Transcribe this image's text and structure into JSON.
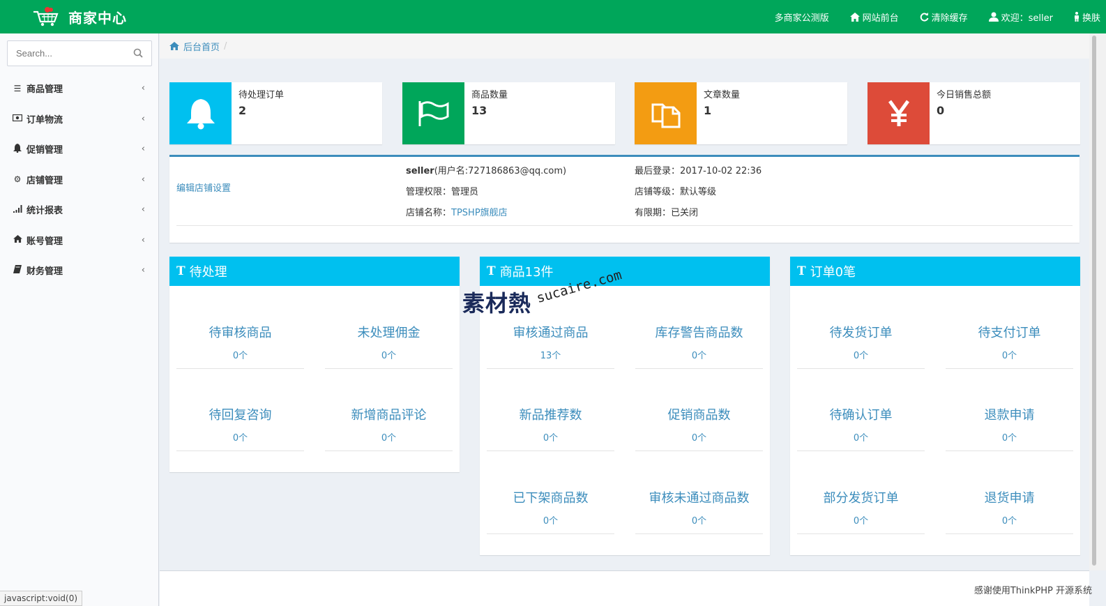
{
  "header": {
    "title": "商家中心",
    "nav": [
      {
        "label": "多商家公测版",
        "icon": ""
      },
      {
        "label": "网站前台",
        "icon": "home-icon"
      },
      {
        "label": "清除缓存",
        "icon": "refresh-icon"
      },
      {
        "label": "欢迎：seller",
        "icon": "user-icon"
      },
      {
        "label": "换肤",
        "icon": "male-icon"
      }
    ]
  },
  "sidebar": {
    "search_placeholder": "Search...",
    "items": [
      {
        "label": "商品管理",
        "icon": "list-icon"
      },
      {
        "label": "订单物流",
        "icon": "money-icon"
      },
      {
        "label": "促销管理",
        "icon": "bell-icon"
      },
      {
        "label": "店铺管理",
        "icon": "gear-icon"
      },
      {
        "label": "统计报表",
        "icon": "signal-icon"
      },
      {
        "label": "账号管理",
        "icon": "home-icon"
      },
      {
        "label": "财务管理",
        "icon": "book-icon"
      }
    ]
  },
  "breadcrumb": {
    "home": "后台首页",
    "sep": "/"
  },
  "infoboxes": [
    {
      "label": "待处理订单",
      "value": "2",
      "icon": "bell-icon",
      "color": "#00c0ef"
    },
    {
      "label": "商品数量",
      "value": "13",
      "icon": "flag-icon",
      "color": "#00a65a"
    },
    {
      "label": "文章数量",
      "value": "1",
      "icon": "files-icon",
      "color": "#f39c12"
    },
    {
      "label": "今日销售总额",
      "value": "0",
      "icon": "yen-icon",
      "color": "#dd4b39"
    }
  ],
  "profile": {
    "edit_link": "编辑店铺设置",
    "username": "seller",
    "username_detail": "(用户名:727186863@qq.com)",
    "role_label": "管理权限：",
    "role_value": "管理员",
    "shop_label": "店铺名称：",
    "shop_value": "TPSHP旗舰店",
    "last_login_label": "最后登录：",
    "last_login_value": "2017-10-02 22:36",
    "level_label": "店铺等级：",
    "level_value": "默认等级",
    "expiry_label": "有限期：",
    "expiry_value": "已关闭"
  },
  "panels": [
    {
      "title": "待处理",
      "stats": [
        {
          "label": "待审核商品",
          "count": "0个"
        },
        {
          "label": "未处理佣金",
          "count": "0个"
        },
        {
          "label": "待回复咨询",
          "count": "0个"
        },
        {
          "label": "新增商品评论",
          "count": "0个"
        }
      ]
    },
    {
      "title": "商品13件",
      "stats": [
        {
          "label": "审核通过商品",
          "count": "13个"
        },
        {
          "label": "库存警告商品数",
          "count": "0个"
        },
        {
          "label": "新品推荐数",
          "count": "0个"
        },
        {
          "label": "促销商品数",
          "count": "0个"
        },
        {
          "label": "已下架商品数",
          "count": "0个"
        },
        {
          "label": "审核未通过商品数",
          "count": "0个"
        }
      ]
    },
    {
      "title": "订单0笔",
      "stats": [
        {
          "label": "待发货订单",
          "count": "0个"
        },
        {
          "label": "待支付订单",
          "count": "0个"
        },
        {
          "label": "待确认订单",
          "count": "0个"
        },
        {
          "label": "退款申请",
          "count": "0个"
        },
        {
          "label": "部分发货订单",
          "count": "0个"
        },
        {
          "label": "退货申请",
          "count": "0个"
        }
      ]
    }
  ],
  "footer": {
    "text": "感谢使用ThinkPHP 开源系统"
  },
  "statusbar": {
    "text": "javascript:void(0)"
  },
  "watermark": {
    "cn": "素材熱",
    "en": "sucaire.com"
  },
  "colors": {
    "header": "#00a65a",
    "panel_head": "#00c0ef",
    "link": "#3c8dbc"
  }
}
